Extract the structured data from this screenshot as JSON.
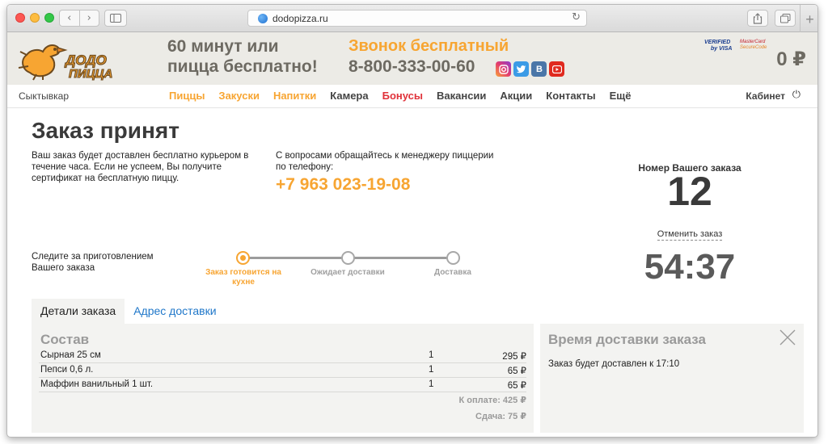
{
  "browser": {
    "url": "dodopizza.ru",
    "nav_back": "‹",
    "nav_forward": "›",
    "reload": "↻",
    "new_tab": "+"
  },
  "header": {
    "logo_text": "ДОДО ПИЦЦА",
    "promo_line1": "60 минут или",
    "promo_line2": "пицца бесплатно!",
    "call_free": "Звонок бесплатный",
    "call_number": "8-800-333-00-60",
    "social": [
      "instagram-icon",
      "twitter-icon",
      "vk-icon",
      "youtube-icon"
    ],
    "social_vk": "В",
    "verified_line1": "VERIFIED",
    "verified_line2": "by VISA",
    "mastercard_line1": "MasterCard",
    "mastercard_line2": "SecureCode",
    "cart_total": "0 ₽"
  },
  "nav": {
    "city": "Сыктывкар",
    "items": [
      {
        "label": "Пиццы",
        "color": "#f7a532"
      },
      {
        "label": "Закуски",
        "color": "#f7a532"
      },
      {
        "label": "Напитки",
        "color": "#f7a532"
      },
      {
        "label": "Камера",
        "color": "#444444"
      },
      {
        "label": "Бонусы",
        "color": "#e0323a"
      },
      {
        "label": "Вакансии",
        "color": "#444444"
      },
      {
        "label": "Акции",
        "color": "#444444"
      },
      {
        "label": "Контакты",
        "color": "#444444"
      },
      {
        "label": "Ещё",
        "color": "#444444"
      }
    ],
    "cabinet": "Кабинет",
    "power_icon": "⏻"
  },
  "order": {
    "title": "Заказ принят",
    "delivery_note": "Ваш заказ будет доставлен бесплатно курьером в течение часа. Если не успеем, Вы получите сертификат на бесплатную пиццу.",
    "contact_note": "С вопросами обращайтесь к менеджеру пиццерии по телефону:",
    "contact_phone": "+7 963 023-19-08",
    "number_label": "Номер Вашего заказа",
    "number": "12",
    "cancel": "Отменить заказ",
    "timer": "54:37",
    "follow_note": "Следите за приготовлением Вашего заказа",
    "steps": [
      {
        "label": "Заказ готовится на кухне",
        "active": true
      },
      {
        "label": "Ожидает доставки",
        "active": false
      },
      {
        "label": "Доставка",
        "active": false
      }
    ]
  },
  "tabs": {
    "details": "Детали заказа",
    "address": "Адрес доставки"
  },
  "composition": {
    "title": "Состав",
    "items": [
      {
        "name": "Сырная 25 см",
        "qty": "1",
        "price": "295 ₽"
      },
      {
        "name": "Пепси 0,6 л.",
        "qty": "1",
        "price": "65 ₽"
      },
      {
        "name": "Маффин ванильный 1 шт.",
        "qty": "1",
        "price": "65 ₽"
      }
    ],
    "to_pay": "К оплате: 425 ₽",
    "change": "Сдача: 75 ₽"
  },
  "delivery_time": {
    "title": "Время доставки заказа",
    "text": "Заказ будет доставлен к 17:10"
  },
  "colors": {
    "accent": "#f7a532",
    "text_dark": "#3a3a3a",
    "link": "#1f77c9",
    "bonus": "#e0323a"
  }
}
